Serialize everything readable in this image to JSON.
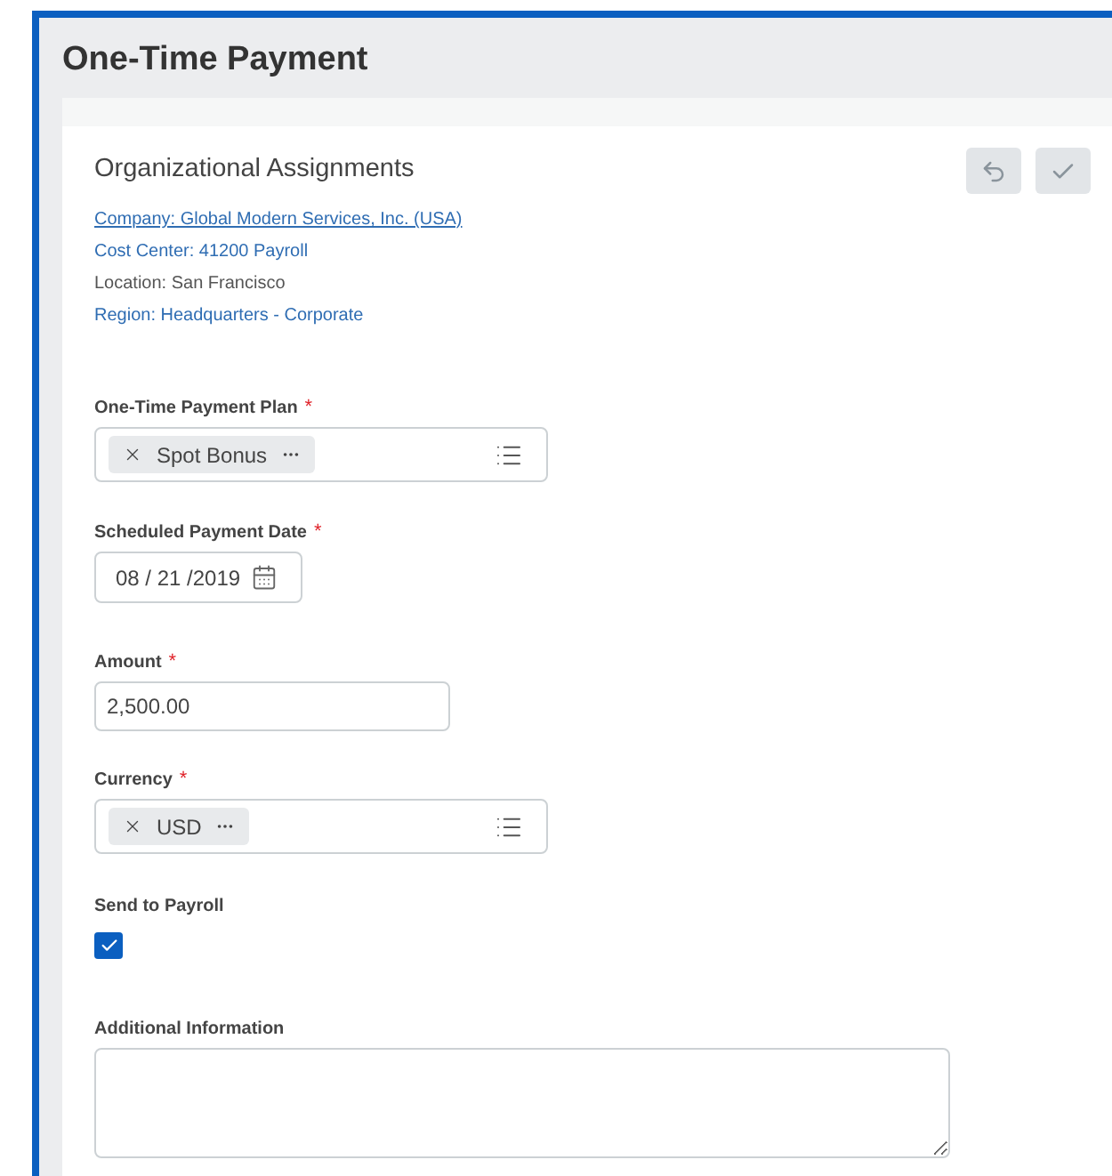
{
  "page_title": "One-Time Payment",
  "section": {
    "title": "Organizational Assignments",
    "details": [
      {
        "text": "Company: Global Modern Services, Inc. (USA)",
        "link": true,
        "underlined": true
      },
      {
        "text": "Cost Center: 41200 Payroll",
        "link": true,
        "underlined": false
      },
      {
        "text": "Location: San Francisco",
        "link": false,
        "underlined": false
      },
      {
        "text": "Region: Headquarters - Corporate",
        "link": true,
        "underlined": false
      }
    ]
  },
  "fields": [
    {
      "kind": "select",
      "label": "One-Time Payment Plan",
      "required_mark": "*",
      "value": "Spot Bonus"
    },
    {
      "kind": "date",
      "label": "Scheduled Payment Date",
      "required_mark": "*",
      "value": "08 / 21 /2019"
    },
    {
      "kind": "text",
      "label": "Amount",
      "required_mark": "*",
      "value": "2,500.00"
    },
    {
      "kind": "select",
      "label": "Currency",
      "required_mark": "*",
      "value": "USD"
    },
    {
      "kind": "checkbox",
      "label": "Send to Payroll",
      "checked": true
    },
    {
      "kind": "textarea",
      "label": "Additional Information"
    }
  ]
}
